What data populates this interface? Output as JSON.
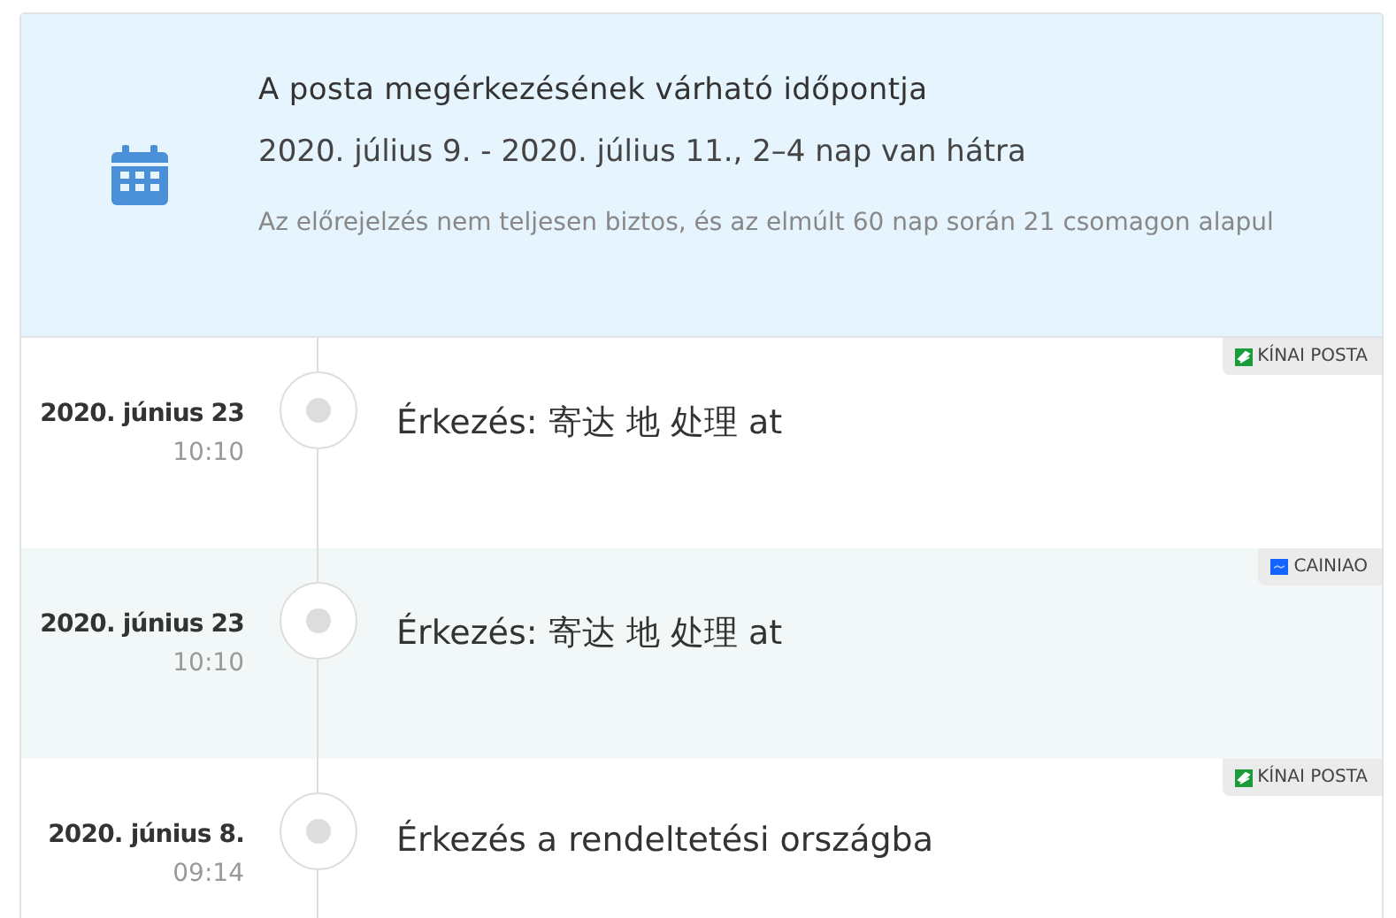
{
  "estimate": {
    "title": "A posta megérkezésének várható időpontja",
    "range": "2020. július 9. - 2020. július 11., 2–4 nap van hátra",
    "note": "Az előrejelzés nem teljesen biztos, és az elmúlt 60 nap során 21 csomagon alapul"
  },
  "events": [
    {
      "date": "2020. június 23",
      "time": "10:10",
      "text": "Érkezés: 寄达 地 处理 at",
      "carrier": {
        "kind": "china-post",
        "name": "KÍNAI POSTA"
      }
    },
    {
      "date": "2020. június 23",
      "time": "10:10",
      "text": "Érkezés: 寄达 地 处理 at",
      "carrier": {
        "kind": "cainiao",
        "name": "CAINIAO"
      }
    },
    {
      "date": "2020. június 8.",
      "time": "09:14",
      "text": "Érkezés a rendeltetési országba",
      "carrier": {
        "kind": "china-post",
        "name": "KÍNAI POSTA"
      }
    }
  ]
}
